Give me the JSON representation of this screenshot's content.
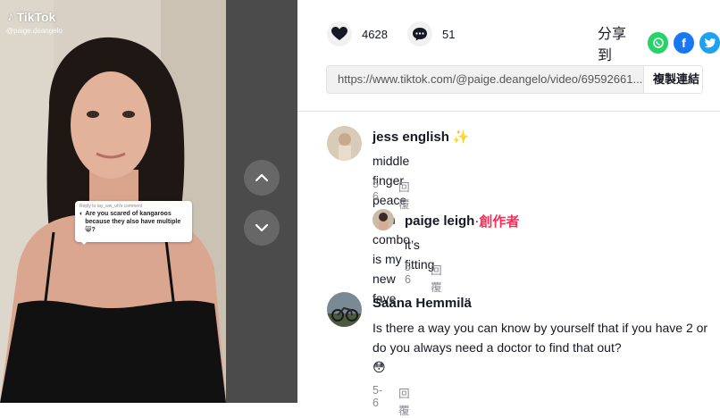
{
  "video": {
    "brand": "TikTok",
    "username": "@paige.deangelo",
    "reply_bubble": {
      "header": "Reply to tay_ww_uh's comment",
      "text": "Are you scared of kangaroos because they also have multiple 😸?"
    }
  },
  "stats": {
    "likes": "4628",
    "comments": "51"
  },
  "share": {
    "label": "分享到",
    "icons": [
      "whatsapp-icon",
      "facebook-icon",
      "twitter-icon"
    ]
  },
  "link": {
    "url": "https://www.tiktok.com/@paige.deangelo/video/69592661...",
    "copy_label": "複製連結"
  },
  "comments": [
    {
      "name": "jess english",
      "badge": "✨",
      "text": "middle finger peace sign combo is my new fave",
      "date": "5-6",
      "reply": "回覆"
    },
    {
      "name": "paige leigh",
      "sep": " · ",
      "creator": "創作者",
      "text": "it’s fitting",
      "date": "5-6",
      "reply": "回覆"
    },
    {
      "name": "Saana Hemmilä",
      "text": "Is there a way you can know by yourself that if you have 2 or do you always need a doctor to find that out?",
      "emoji": "😳",
      "date": "5-6",
      "reply": "回覆"
    }
  ],
  "colors": {
    "accent": "#fe2c55",
    "whatsapp": "#25d366",
    "facebook": "#1877f2",
    "twitter": "#1da1f2"
  }
}
